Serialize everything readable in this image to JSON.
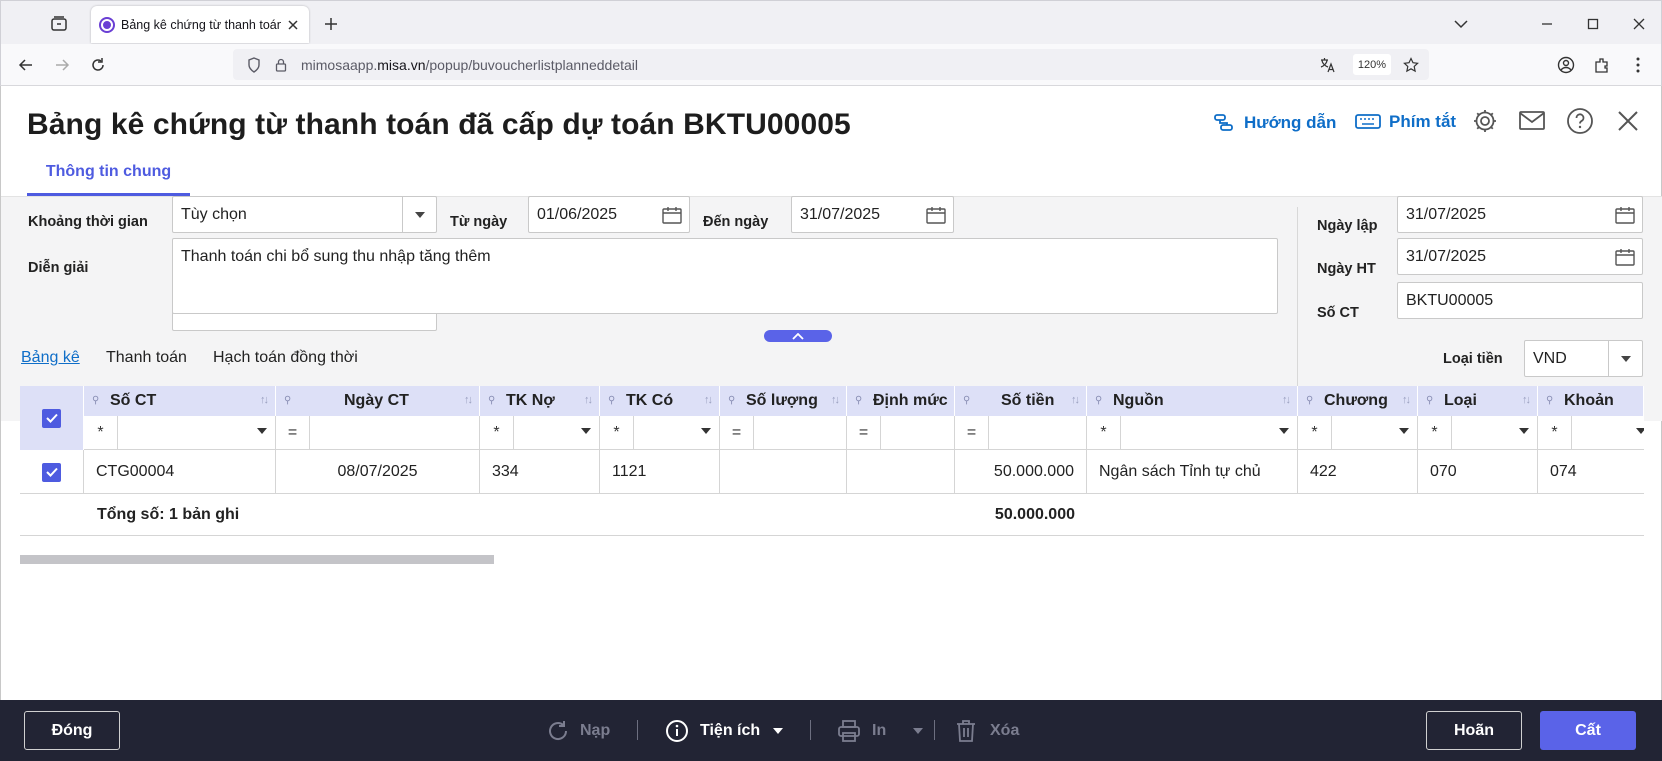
{
  "browser": {
    "tab_title": "Bảng kê chứng từ thanh toán đ",
    "url_domain_prefix": "mimosaapp.",
    "url_domain": "misa.vn",
    "url_path": "/popup/buvoucherlistplanneddetail",
    "zoom": "120%"
  },
  "header": {
    "title": "Bảng kê chứng từ thanh toán đã cấp dự toán BKTU00005",
    "guide_label": "Hướng dẫn",
    "shortcut_label": "Phím tắt"
  },
  "tabs": {
    "general": "Thông tin chung"
  },
  "form": {
    "period_label": "Khoảng thời gian",
    "period_value": "Tùy chọn",
    "from_label": "Từ ngày",
    "from_value": "01/06/2025",
    "to_label": "Đến ngày",
    "to_value": "31/07/2025",
    "desc_label": "Diễn giải",
    "desc_value": "Thanh toán chi bổ sung thu nhập tăng thêm",
    "created_label": "Ngày lập",
    "created_value": "31/07/2025",
    "posted_label": "Ngày HT",
    "posted_value": "31/07/2025",
    "voucher_no_label": "Số CT",
    "voucher_no_value": "BKTU00005"
  },
  "subtabs": {
    "list": "Bảng kê",
    "payment": "Thanh toán",
    "accounting": "Hạch toán đồng thời",
    "currency_label": "Loại tiền",
    "currency_value": "VND"
  },
  "grid": {
    "columns": [
      "Số CT",
      "Ngày CT",
      "TK Nợ",
      "TK Có",
      "Số lượng",
      "Định mức",
      "Số tiền",
      "Nguồn",
      "Chương",
      "Loại",
      "Khoản"
    ],
    "filter_ops": [
      "*",
      "=",
      "*",
      "*",
      "=",
      "=",
      "=",
      "*",
      "*",
      "*",
      "*"
    ],
    "rows": [
      {
        "so_ct": "CTG00004",
        "ngay_ct": "08/07/2025",
        "tk_no": "334",
        "tk_co": "1121",
        "so_luong": "",
        "dinh_muc": "",
        "so_tien": "50.000.000",
        "nguon": "Ngân sách Tỉnh tự chủ",
        "chuong": "422",
        "loai": "070",
        "khoan": "074"
      }
    ],
    "total_prefix": "Tổng số: ",
    "total_count": "1",
    "total_suffix": " bản ghi",
    "total_amount": "50.000.000"
  },
  "footer": {
    "close": "Đóng",
    "reload": "Nạp",
    "utilities": "Tiện ích",
    "print": "In",
    "delete": "Xóa",
    "cancel": "Hoãn",
    "save": "Cất"
  },
  "colors": {
    "accent": "#4e5be0",
    "link": "#0f6ec8",
    "footer_bg": "#222434"
  }
}
